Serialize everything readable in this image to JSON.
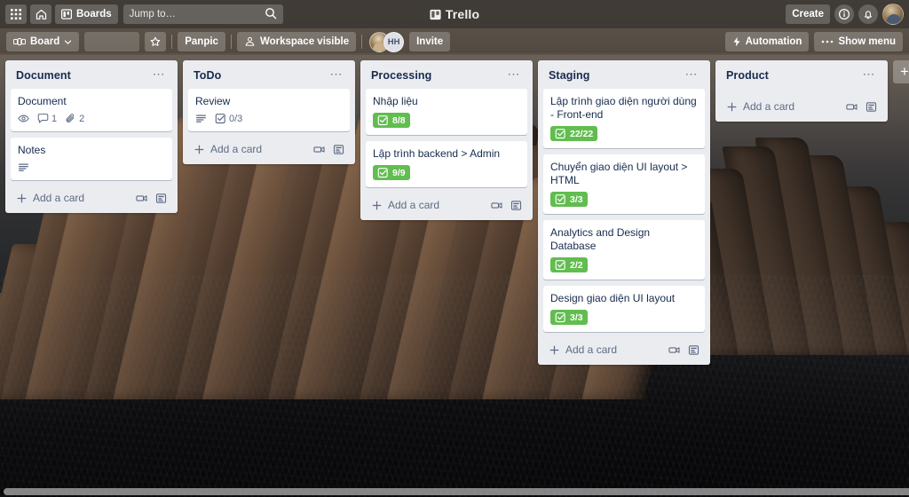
{
  "topnav": {
    "apps_icon": "grid-apps-icon",
    "home_icon": "home-icon",
    "boards_label": "Boards",
    "boards_icon": "board-icon",
    "search_placeholder": "Jump to…",
    "search_value": "",
    "search_icon": "search-icon",
    "brand": "Trello",
    "brand_icon": "trello-logo-icon",
    "create_label": "Create",
    "info_icon": "info-icon",
    "notifications_icon": "bell-icon",
    "avatar_name": "user-avatar"
  },
  "boardbar": {
    "board_label": "Board",
    "board_icon": "board-views-icon",
    "chevron_icon": "chevron-down-icon",
    "board_title": "",
    "star_icon": "star-icon",
    "workspace_label": "Panpic",
    "visibility_label": "Workspace visible",
    "visibility_icon": "workspace-visible-icon",
    "members": [
      {
        "name": "member-avatar-photo",
        "initials": "",
        "badge": "+"
      },
      {
        "name": "member-avatar-hh",
        "initials": "HH",
        "badge": ""
      }
    ],
    "invite_label": "Invite",
    "automation_label": "Automation",
    "automation_icon": "lightning-icon",
    "show_menu_label": "Show menu",
    "show_menu_icon": "ellipsis-icon"
  },
  "colors": {
    "nav_bg": "#38342f",
    "list_bg": "#ebecf0",
    "card_bg": "#ffffff",
    "text_dark": "#172b4d",
    "text_muted": "#5e6c84",
    "checklist_green": "#61bd4f",
    "brand_white": "#ffffff"
  },
  "board": {
    "add_list_label": "+",
    "lists": [
      {
        "title": "Document",
        "menu": "⋯",
        "add_card_label": "Add a card",
        "cards": [
          {
            "title": "Document",
            "badges": [
              {
                "type": "watch",
                "icon": "eye-icon",
                "text": ""
              },
              {
                "type": "comments",
                "icon": "comment-icon",
                "text": "1"
              },
              {
                "type": "attachments",
                "icon": "paperclip-icon",
                "text": "2"
              }
            ]
          },
          {
            "title": "Notes",
            "badges": [
              {
                "type": "description",
                "icon": "description-icon",
                "text": ""
              }
            ]
          }
        ]
      },
      {
        "title": "ToDo",
        "menu": "⋯",
        "add_card_label": "Add a card",
        "cards": [
          {
            "title": "Review",
            "badges": [
              {
                "type": "description",
                "icon": "description-icon",
                "text": ""
              },
              {
                "type": "checklist",
                "icon": "checklist-icon",
                "text": "0/3"
              }
            ]
          }
        ]
      },
      {
        "title": "Processing",
        "menu": "⋯",
        "add_card_label": "Add a card",
        "cards": [
          {
            "title": "Nhập liệu",
            "badges": [
              {
                "type": "checklist-complete",
                "icon": "checklist-icon",
                "text": "8/8"
              }
            ]
          },
          {
            "title": "Lập trình backend > Admin",
            "badges": [
              {
                "type": "checklist-complete",
                "icon": "checklist-icon",
                "text": "9/9"
              }
            ]
          }
        ]
      },
      {
        "title": "Staging",
        "menu": "⋯",
        "add_card_label": "Add a card",
        "cards": [
          {
            "title": "Lập trình giao diện người dùng - Front-end",
            "badges": [
              {
                "type": "checklist-complete",
                "icon": "checklist-icon",
                "text": "22/22"
              }
            ]
          },
          {
            "title": "Chuyển giao diện UI layout > HTML",
            "badges": [
              {
                "type": "checklist-complete",
                "icon": "checklist-icon",
                "text": "3/3"
              }
            ]
          },
          {
            "title": "Analytics and Design Database",
            "badges": [
              {
                "type": "checklist-complete",
                "icon": "checklist-icon",
                "text": "2/2"
              }
            ]
          },
          {
            "title": "Design giao diện UI layout",
            "badges": [
              {
                "type": "checklist-complete",
                "icon": "checklist-icon",
                "text": "3/3"
              }
            ]
          }
        ]
      },
      {
        "title": "Product",
        "menu": "⋯",
        "add_card_label": "Add a card",
        "cards": []
      }
    ]
  }
}
